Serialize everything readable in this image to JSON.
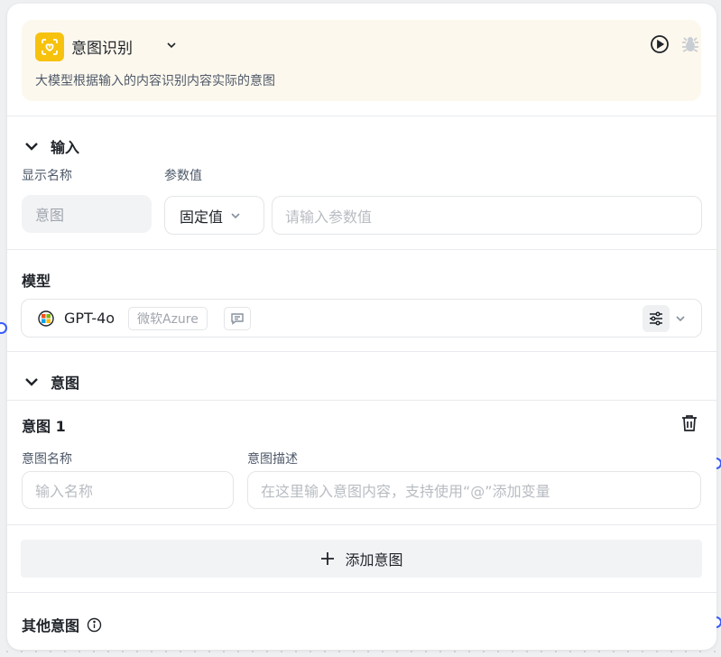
{
  "node": {
    "title": "意图识别",
    "description": "大模型根据输入的内容识别内容实际的意图",
    "accent_color": "#f7c20e",
    "icons": [
      "intent-icon",
      "chevron-down-icon",
      "play-icon",
      "bug-icon"
    ]
  },
  "input_section": {
    "title": "输入",
    "display_name_label": "显示名称",
    "param_value_label": "参数值",
    "display_name_value": "意图",
    "value_type": "固定值",
    "value_placeholder": "请输入参数值"
  },
  "model_section": {
    "title": "模型",
    "model_name": "GPT-4o",
    "provider_tag": "微软Azure",
    "icons": [
      "model-logo-icon",
      "chat-icon",
      "sliders-icon",
      "chevron-down-icon"
    ]
  },
  "intent_section": {
    "title": "意图",
    "items": [
      {
        "title": "意图 1",
        "name_label": "意图名称",
        "desc_label": "意图描述",
        "name_placeholder": "输入名称",
        "desc_placeholder": "在这里输入意图内容，支持使用“@”添加变量"
      }
    ],
    "add_button_label": "添加意图"
  },
  "other_section": {
    "title": "其他意图"
  },
  "colors": {
    "handle": "#3b5bfd",
    "header_bg": "#fdf8ed"
  }
}
